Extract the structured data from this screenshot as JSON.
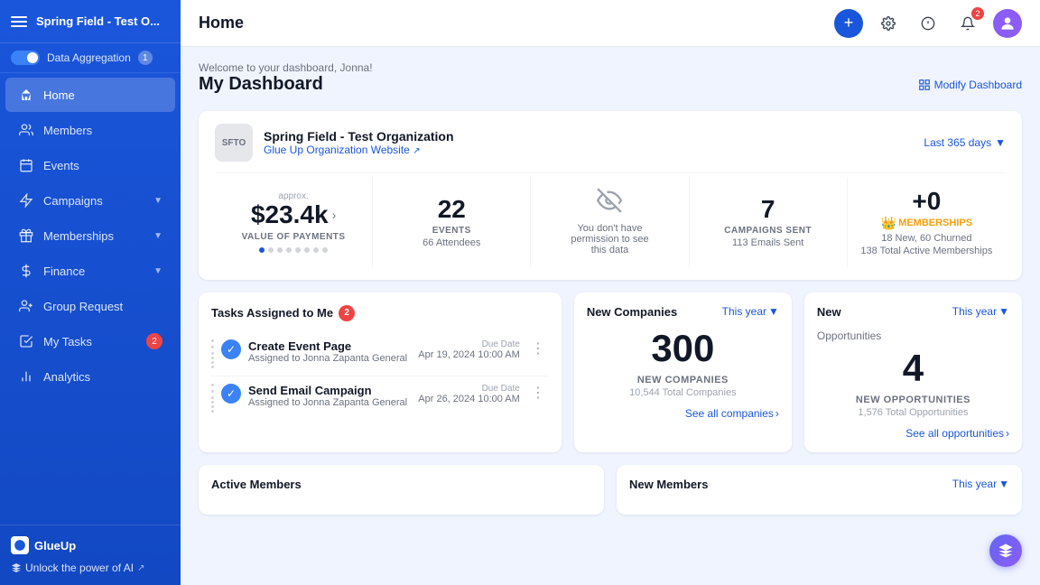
{
  "sidebar": {
    "org_name": "Spring Field - Test O...",
    "toggle_label": "Data Aggregation",
    "toggle_badge": "1",
    "nav_items": [
      {
        "id": "home",
        "label": "Home",
        "icon": "home",
        "active": true
      },
      {
        "id": "members",
        "label": "Members",
        "icon": "members"
      },
      {
        "id": "events",
        "label": "Events",
        "icon": "events"
      },
      {
        "id": "campaigns",
        "label": "Campaigns",
        "icon": "campaigns",
        "has_arrow": true
      },
      {
        "id": "memberships",
        "label": "Memberships",
        "icon": "memberships",
        "has_arrow": true
      },
      {
        "id": "finance",
        "label": "Finance",
        "icon": "finance",
        "has_arrow": true
      },
      {
        "id": "group-request",
        "label": "Group Request",
        "icon": "group"
      },
      {
        "id": "my-tasks",
        "label": "My Tasks",
        "icon": "tasks",
        "badge": "2"
      },
      {
        "id": "analytics",
        "label": "Analytics",
        "icon": "analytics"
      }
    ],
    "footer": {
      "logo_text": "GlueUp",
      "unlock_ai": "Unlock the power of AI"
    }
  },
  "topbar": {
    "title": "Home",
    "notification_count": "2"
  },
  "dashboard": {
    "welcome": "Welcome to your dashboard, Jonna!",
    "title": "My Dashboard",
    "modify_label": "Modify Dashboard"
  },
  "org": {
    "name": "Spring Field - Test Organization",
    "website": "Glue Up Organization Website",
    "logo_abbr": "SFTO",
    "last_days": "Last 365 days"
  },
  "stats": [
    {
      "id": "payments",
      "approx": "approx.",
      "value": "$23.4k",
      "label": "VALUE OF PAYMENTS",
      "has_nav": true
    },
    {
      "id": "events",
      "value": "22",
      "label": "EVENTS",
      "sub": "66 Attendees"
    },
    {
      "id": "permissions",
      "blocked": true,
      "message": "You don't have permission to see this data"
    },
    {
      "id": "campaigns",
      "value": "7",
      "label": "CAMPAIGNS SENT",
      "sub": "113 Emails Sent"
    },
    {
      "id": "memberships",
      "value": "+0",
      "label": "MEMBERSHIPS",
      "badge": "MEMBERSHIPS",
      "new": "18 New, 60 Churned",
      "total": "138 Total Active Memberships"
    }
  ],
  "tasks": {
    "title": "Tasks Assigned to Me",
    "badge": "2",
    "items": [
      {
        "id": "task1",
        "title": "Create Event Page",
        "assigned": "Assigned to Jonna Zapanta General",
        "date": "Apr 19, 2024 10:00 AM",
        "date_label": "Due Date"
      },
      {
        "id": "task2",
        "title": "Send Email Campaign",
        "assigned": "Assigned to Jonna Zapanta General",
        "date": "Apr 26, 2024 10:00 AM",
        "date_label": "Due Date"
      }
    ]
  },
  "companies": {
    "title": "New Companies",
    "this_year": "This year",
    "value": "300",
    "label": "NEW COMPANIES",
    "total": "10,544 Total Companies",
    "see_all": "See all companies"
  },
  "opportunities": {
    "title": "New",
    "this_year": "This year",
    "opp_label": "Opportunities",
    "value": "4",
    "label": "NEW OPPORTUNITIES",
    "total": "1,576 Total Opportunities",
    "see_all": "See all opportunities"
  },
  "active_members": {
    "title": "Active Members"
  },
  "new_members": {
    "title": "New Members",
    "this_year": "This year"
  }
}
